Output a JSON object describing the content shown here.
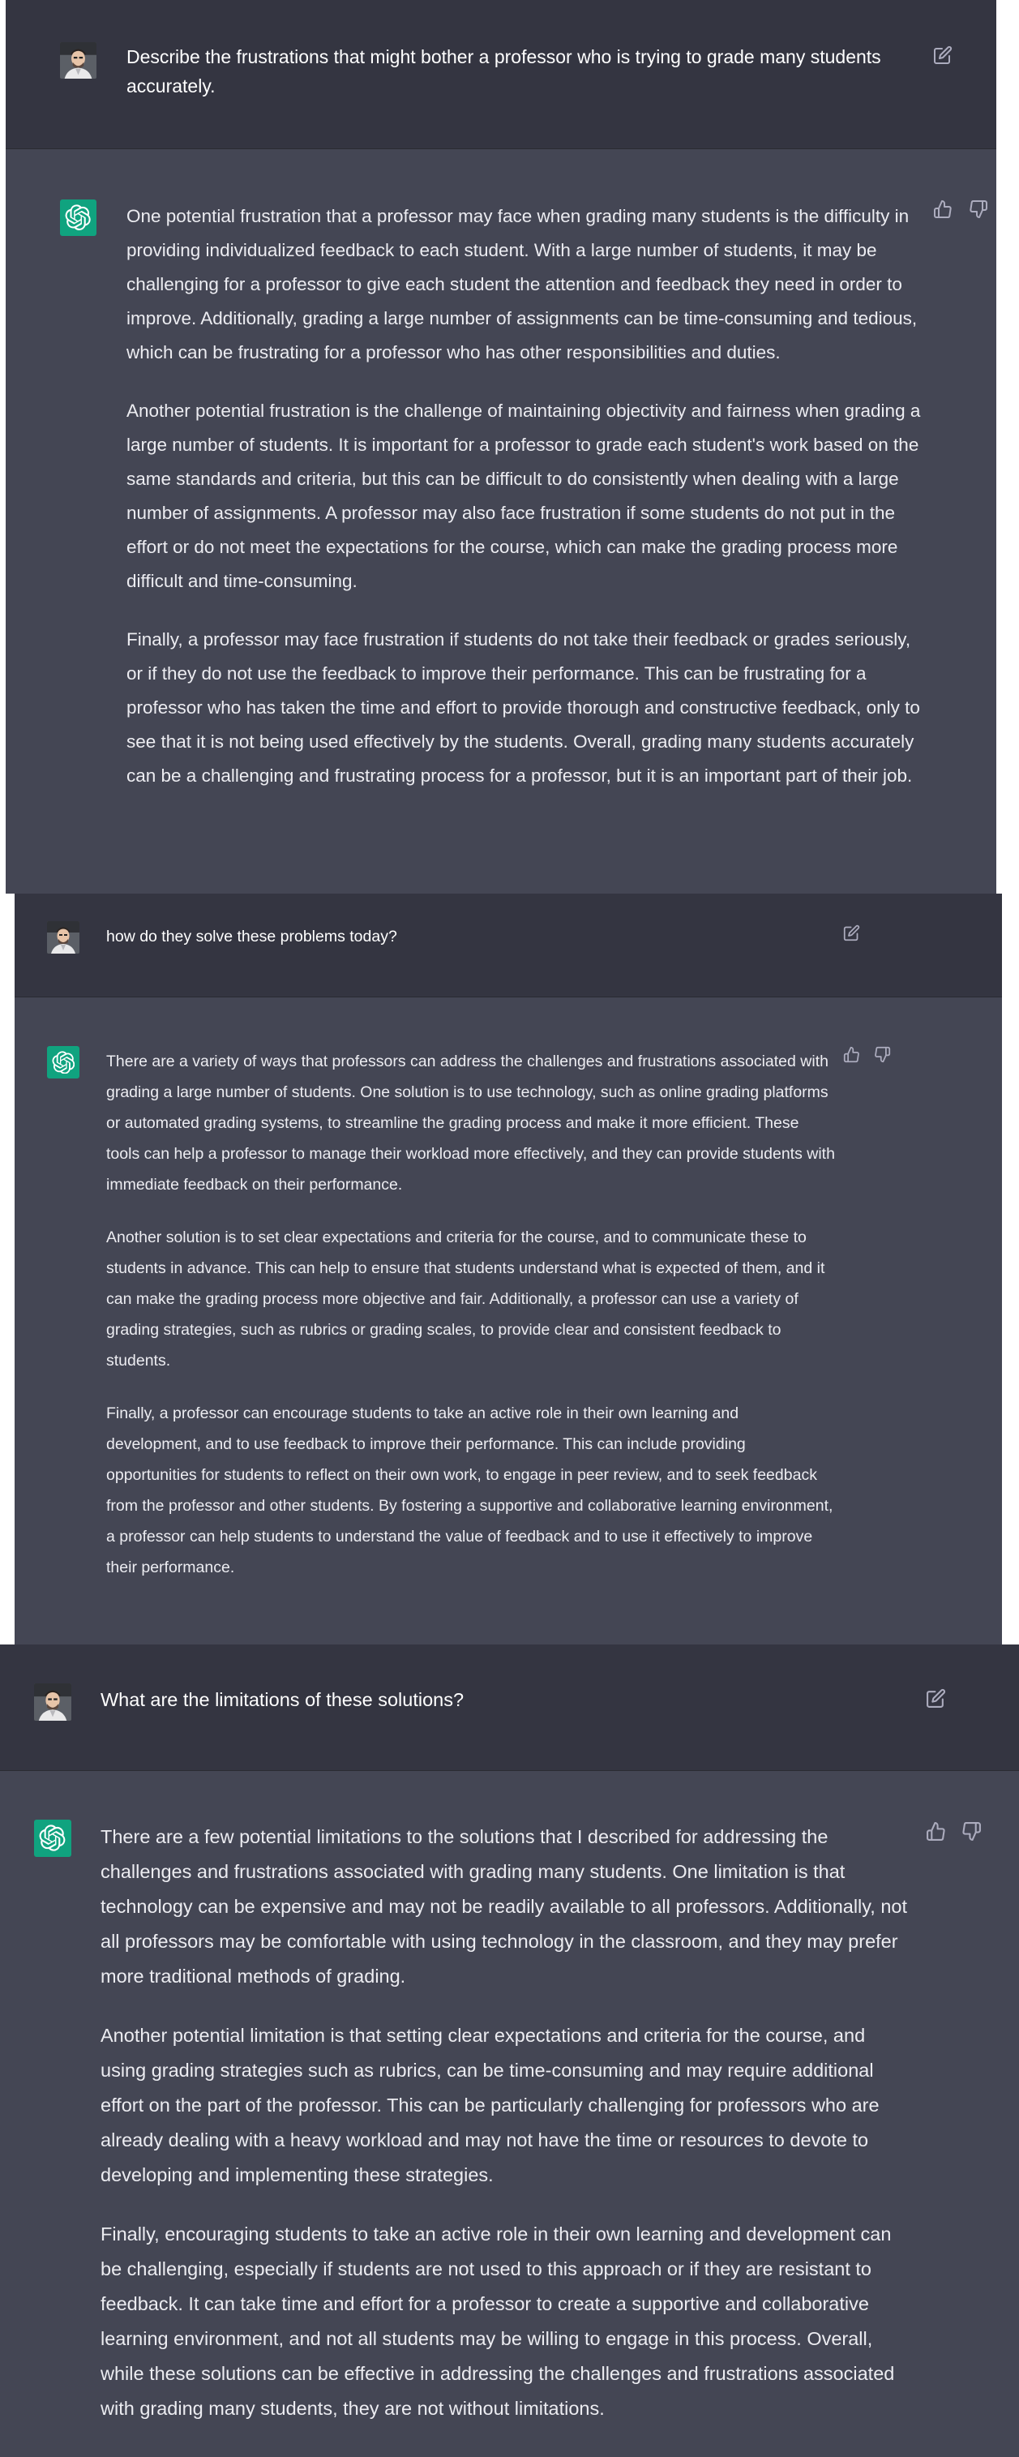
{
  "colors": {
    "user_bg": "#343541",
    "assistant_bg": "#444654",
    "assistant_avatar": "#10a37f",
    "text": "#ececf1",
    "icon": "#acacbe"
  },
  "icons": {
    "user_avatar": "user-avatar-photo",
    "assistant_avatar": "openai-logo-icon",
    "edit": "edit-icon",
    "thumbs_up": "thumbs-up-icon",
    "thumbs_down": "thumbs-down-icon"
  },
  "conversation": [
    {
      "role": "user",
      "text": "Describe the frustrations that might bother a professor who is trying to grade many students accurately."
    },
    {
      "role": "assistant",
      "paragraphs": [
        "One potential frustration that a professor may face when grading many students is the difficulty in providing individualized feedback to each student. With a large number of students, it may be challenging for a professor to give each student the attention and feedback they need in order to improve. Additionally, grading a large number of assignments can be time-consuming and tedious, which can be frustrating for a professor who has other responsibilities and duties.",
        "Another potential frustration is the challenge of maintaining objectivity and fairness when grading a large number of students. It is important for a professor to grade each student's work based on the same standards and criteria, but this can be difficult to do consistently when dealing with a large number of assignments. A professor may also face frustration if some students do not put in the effort or do not meet the expectations for the course, which can make the grading process more difficult and time-consuming.",
        "Finally, a professor may face frustration if students do not take their feedback or grades seriously, or if they do not use the feedback to improve their performance. This can be frustrating for a professor who has taken the time and effort to provide thorough and constructive feedback, only to see that it is not being used effectively by the students. Overall, grading many students accurately can be a challenging and frustrating process for a professor, but it is an important part of their job."
      ]
    },
    {
      "role": "user",
      "text": "how do they solve these problems today?"
    },
    {
      "role": "assistant",
      "paragraphs": [
        "There are a variety of ways that professors can address the challenges and frustrations associated with grading a large number of students. One solution is to use technology, such as online grading platforms or automated grading systems, to streamline the grading process and make it more efficient. These tools can help a professor to manage their workload more effectively, and they can provide students with immediate feedback on their performance.",
        "Another solution is to set clear expectations and criteria for the course, and to communicate these to students in advance. This can help to ensure that students understand what is expected of them, and it can make the grading process more objective and fair. Additionally, a professor can use a variety of grading strategies, such as rubrics or grading scales, to provide clear and consistent feedback to students.",
        "Finally, a professor can encourage students to take an active role in their own learning and development, and to use feedback to improve their performance. This can include providing opportunities for students to reflect on their own work, to engage in peer review, and to seek feedback from the professor and other students. By fostering a supportive and collaborative learning environment, a professor can help students to understand the value of feedback and to use it effectively to improve their performance."
      ]
    },
    {
      "role": "user",
      "text": "What are the limitations of these solutions?"
    },
    {
      "role": "assistant",
      "paragraphs": [
        "There are a few potential limitations to the solutions that I described for addressing the challenges and frustrations associated with grading many students. One limitation is that technology can be expensive and may not be readily available to all professors. Additionally, not all professors may be comfortable with using technology in the classroom, and they may prefer more traditional methods of grading.",
        "Another potential limitation is that setting clear expectations and criteria for the course, and using grading strategies such as rubrics, can be time-consuming and may require additional effort on the part of the professor. This can be particularly challenging for professors who are already dealing with a heavy workload and may not have the time or resources to devote to developing and implementing these strategies.",
        "Finally, encouraging students to take an active role in their own learning and development can be challenging, especially if students are not used to this approach or if they are resistant to feedback. It can take time and effort for a professor to create a supportive and collaborative learning environment, and not all students may be willing to engage in this process. Overall, while these solutions can be effective in addressing the challenges and frustrations associated with grading many students, they are not without limitations."
      ]
    }
  ]
}
